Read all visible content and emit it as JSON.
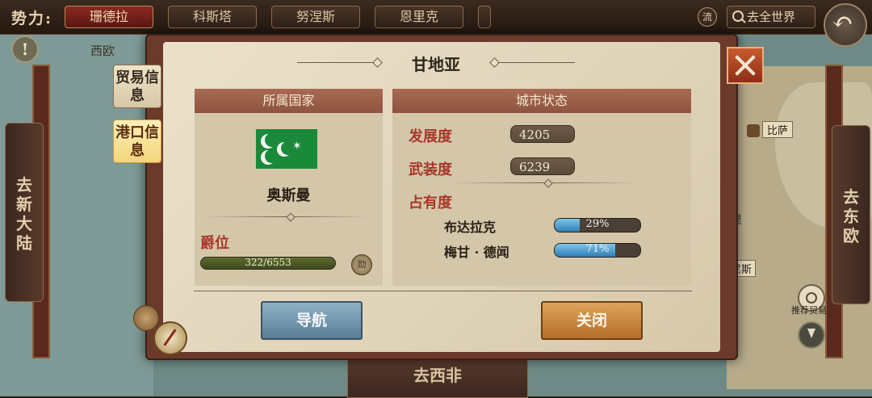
{
  "topbar": {
    "faction_label": "势力:",
    "tabs": [
      "珊德拉",
      "科斯塔",
      "努涅斯",
      "恩里克"
    ],
    "flow_label": "流",
    "go_world": "去全世界"
  },
  "map": {
    "region_west_europe": "西欧",
    "city_pisa": "比萨",
    "partial_label_li": "里",
    "partial_label_ni": "尼斯",
    "trade_label": "推荐贸易",
    "left_nav": "去新大陆",
    "right_nav": "去东欧",
    "bottom_nav": "去西非"
  },
  "dialog": {
    "title": "甘地亚",
    "side_tabs": {
      "trade": "贸易信息",
      "port": "港口信息"
    },
    "country_panel": {
      "header": "所属国家",
      "country_name": "奥斯曼",
      "rank_label": "爵位",
      "rank_progress": "322/6553",
      "rank_fraction": 0.049,
      "medal_glyph": "勋"
    },
    "city_panel": {
      "header": "城市状态",
      "development_label": "发展度",
      "development_value": "4205",
      "armament_label": "武装度",
      "armament_value": "6239",
      "occupancy_label": "占有度",
      "occupants": [
        {
          "name": "布达拉克",
          "percent_text": "29%",
          "percent": 29
        },
        {
          "name": "梅甘 · 德闻",
          "percent_text": "71%",
          "percent": 71
        }
      ]
    },
    "buttons": {
      "navigate": "导航",
      "close": "关闭"
    }
  }
}
